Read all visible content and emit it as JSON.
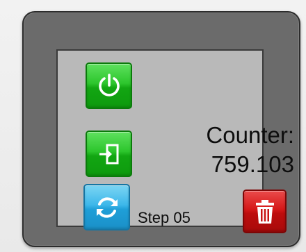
{
  "counter": {
    "label": "Counter:",
    "value": "759.103"
  },
  "step": {
    "label": "Step 05"
  },
  "buttons": {
    "power": {
      "icon": "power-icon",
      "color": "#2cc52c"
    },
    "login": {
      "icon": "login-icon",
      "color": "#2cc52c"
    },
    "refresh": {
      "icon": "refresh-icon",
      "color": "#3cb7ea"
    },
    "delete": {
      "icon": "trash-icon",
      "color": "#d51818"
    }
  },
  "colors": {
    "device_bezel": "#6b6b6b",
    "screen": "#b9b9b9"
  }
}
